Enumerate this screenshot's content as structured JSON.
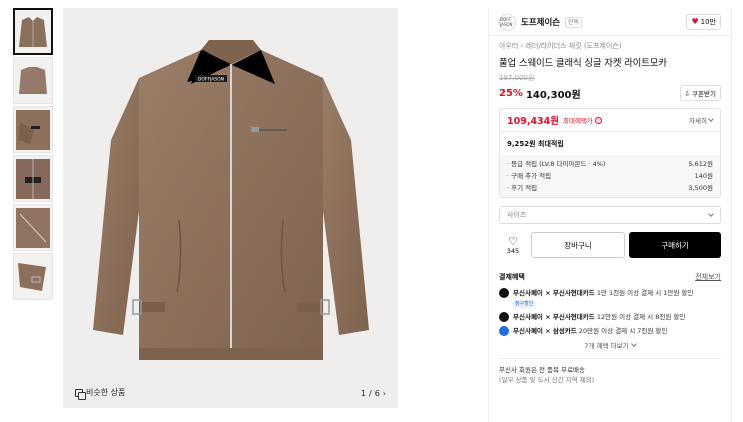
{
  "gallery": {
    "thumbnails": [
      {
        "view": "jacket-front"
      },
      {
        "view": "jacket-back"
      },
      {
        "view": "collar-detail"
      },
      {
        "view": "zip-detail"
      },
      {
        "view": "sleeve-detail"
      },
      {
        "view": "buckle-detail"
      }
    ],
    "main_logo_text": "DOFFJASON",
    "similar_label": "비슷한 상품",
    "pager_current": "1",
    "pager_sep": "/",
    "pager_total": "6"
  },
  "product": {
    "brand_logo_text": "DOFF JASON",
    "brand_name": "도프제이슨",
    "brand_badge": "단독",
    "like_count": "10만",
    "category": "아우터 › 레더/라이더스 재킷 (도프제이슨)",
    "title": "풀업 스웨이드 클래식 싱글 자켓 라이트모카",
    "original_price": "187,000원",
    "discount": "25%",
    "price": "140,300원",
    "coupon_label": "쿠폰받기"
  },
  "benefits": {
    "max_price": "109,434원",
    "max_label": "최대혜택가",
    "detail_label": "자세히",
    "points_head": "9,252원 최대적립",
    "points": [
      {
        "label": "· 등급 적립 (LV.8 다이아몬드 · 4%)",
        "value": "5,612원"
      },
      {
        "label": "· 구매 추가 적립",
        "value": "140원"
      },
      {
        "label": "· 후기 적립",
        "value": "3,500원"
      }
    ]
  },
  "purchase": {
    "size_placeholder": "사이즈",
    "wish_count": "345",
    "cart_label": "장바구니",
    "buy_label": "구매하기"
  },
  "payment": {
    "title": "결제혜택",
    "all_label": "전체보기",
    "items": [
      {
        "brand": "무신사페이 × 무신사현대카드",
        "text": "1만 1천원 이상 결제 시 1만원 할인",
        "badge": "청구할인",
        "color": "#111111"
      },
      {
        "brand": "무신사페이 × 무신사현대카드",
        "text": "12만원 이상 결제 시 8천원 할인",
        "badge": "",
        "color": "#111111"
      },
      {
        "brand": "무신사페이 × 삼성카드",
        "text": "20만원 이상 결제 시 7천원 할인",
        "badge": "",
        "color": "#1e6fe0"
      }
    ],
    "more_label": "7개 혜택 더보기"
  },
  "shipping": {
    "line1": "무신사 회원은 전 품목 무료배송",
    "line2": "(일부 상품 및 도서 산간 지역 제외)"
  }
}
